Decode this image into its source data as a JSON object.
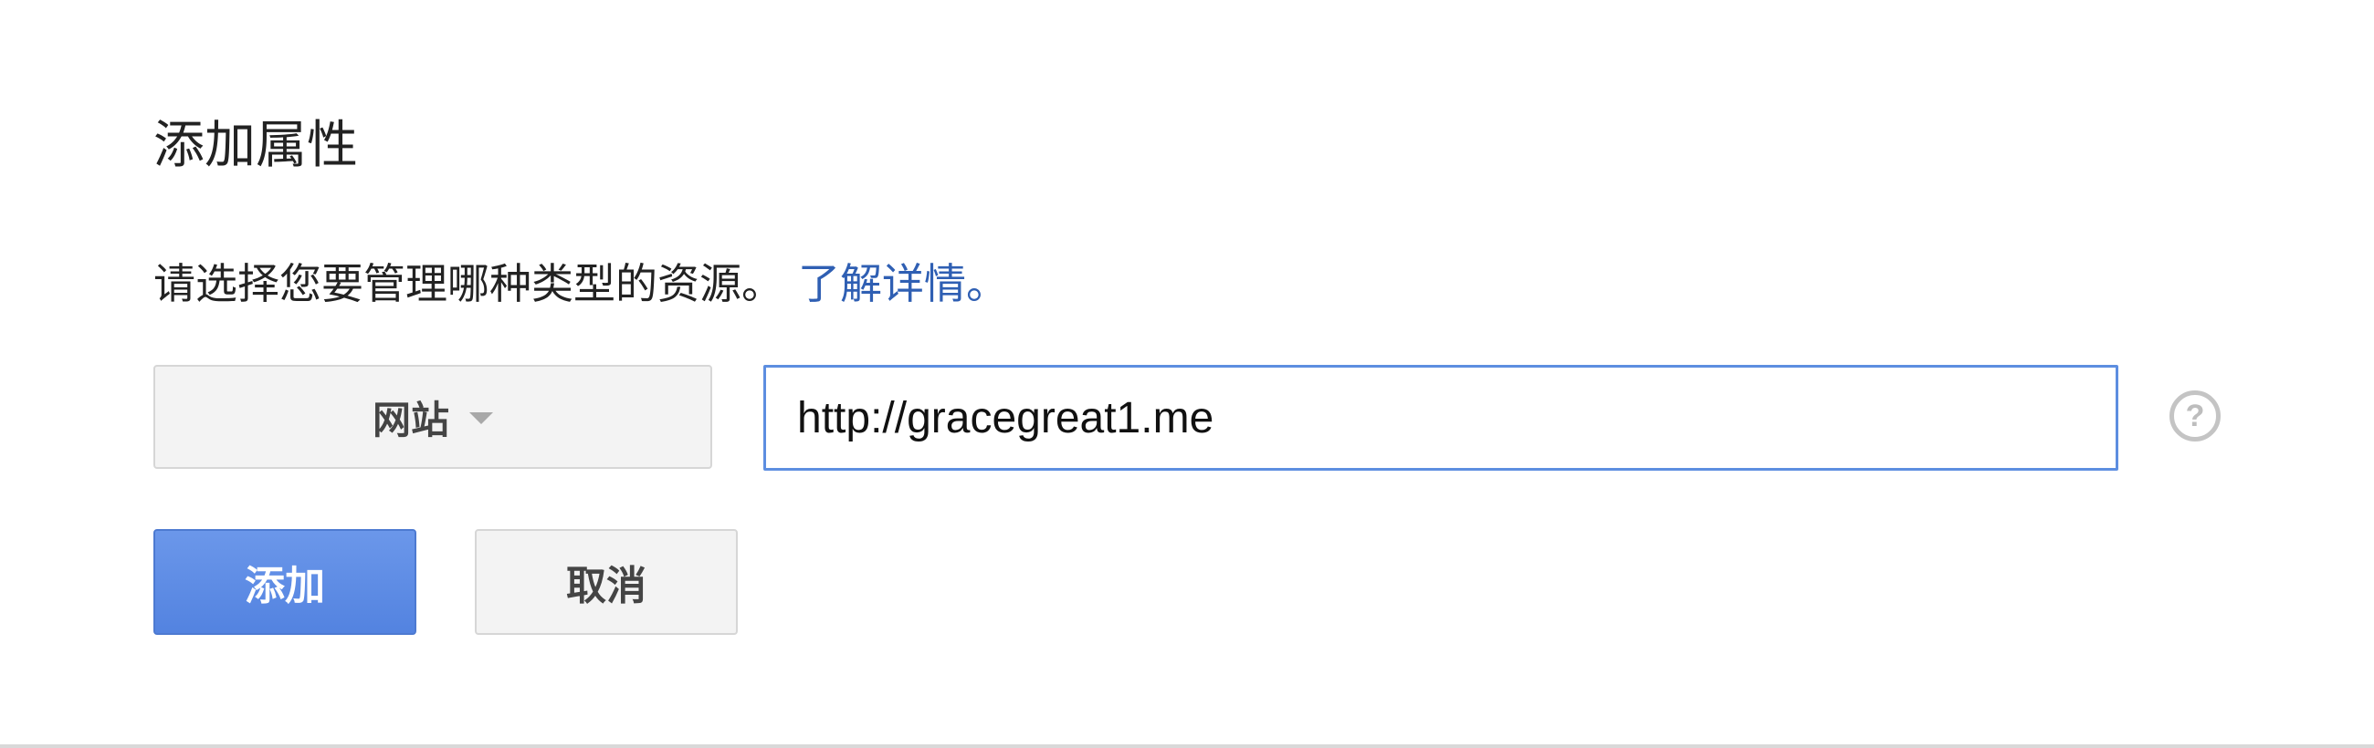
{
  "dialog": {
    "title": "添加属性",
    "description": "请选择您要管理哪种类型的资源。",
    "learn_more_link": "了解详情。"
  },
  "property_type": {
    "selected": "网站",
    "icon": "chevron-down-icon"
  },
  "url_input": {
    "value": "http://gracegreat1.me",
    "placeholder": ""
  },
  "help": {
    "icon": "help-icon",
    "glyph": "?"
  },
  "actions": {
    "add_label": "添加",
    "cancel_label": "取消"
  },
  "colors": {
    "primary_button": "#5d8ee0",
    "link": "#2f5fb3",
    "input_focus_border": "#5d8ee0"
  }
}
